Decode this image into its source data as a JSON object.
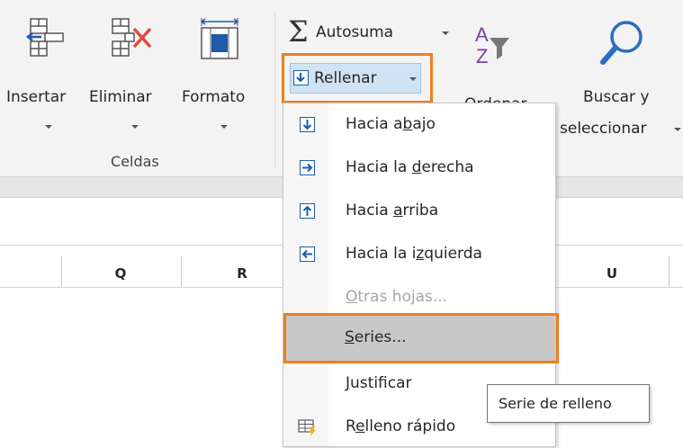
{
  "ribbon": {
    "cells_group": {
      "label": "Celdas",
      "insert_label": "Insertar",
      "delete_label": "Eliminar",
      "format_label": "Formato"
    },
    "editing": {
      "autosum_label": "Autosuma",
      "fill_label": "Rellenar",
      "sort_label": "Ordenar",
      "find_label_line1": "Buscar y",
      "find_label_line2": "seleccionar"
    }
  },
  "columns": [
    "Q",
    "R",
    "U"
  ],
  "fill_menu": {
    "items": [
      {
        "pre": "Hacia a",
        "key": "b",
        "post": "ajo",
        "icon": "fill-down-icon",
        "enabled": true
      },
      {
        "pre": "Hacia la ",
        "key": "d",
        "post": "erecha",
        "icon": "fill-right-icon",
        "enabled": true
      },
      {
        "pre": "Hacia ",
        "key": "a",
        "post": "rriba",
        "icon": "fill-up-icon",
        "enabled": true
      },
      {
        "pre": "Hacia la i",
        "key": "z",
        "post": "quierda",
        "icon": "fill-left-icon",
        "enabled": true
      },
      {
        "pre": "",
        "key": "O",
        "post": "tras hojas...",
        "icon": "",
        "enabled": false
      },
      {
        "pre": "",
        "key": "S",
        "post": "eries...",
        "icon": "",
        "enabled": true,
        "highlighted": true
      },
      {
        "pre": "",
        "key": "J",
        "post": "ustificar",
        "icon": "",
        "enabled": true
      },
      {
        "pre": "R",
        "key": "e",
        "post": "lleno rápido",
        "icon": "flash-fill-icon",
        "enabled": true
      }
    ]
  },
  "tooltip": {
    "text": "Serie de relleno"
  },
  "colors": {
    "highlight_border": "#f07f1b",
    "icon_blue": "#1e5ba8",
    "sort_icon_purple": "#7b3fa0",
    "find_icon_blue": "#2b6cc4"
  }
}
